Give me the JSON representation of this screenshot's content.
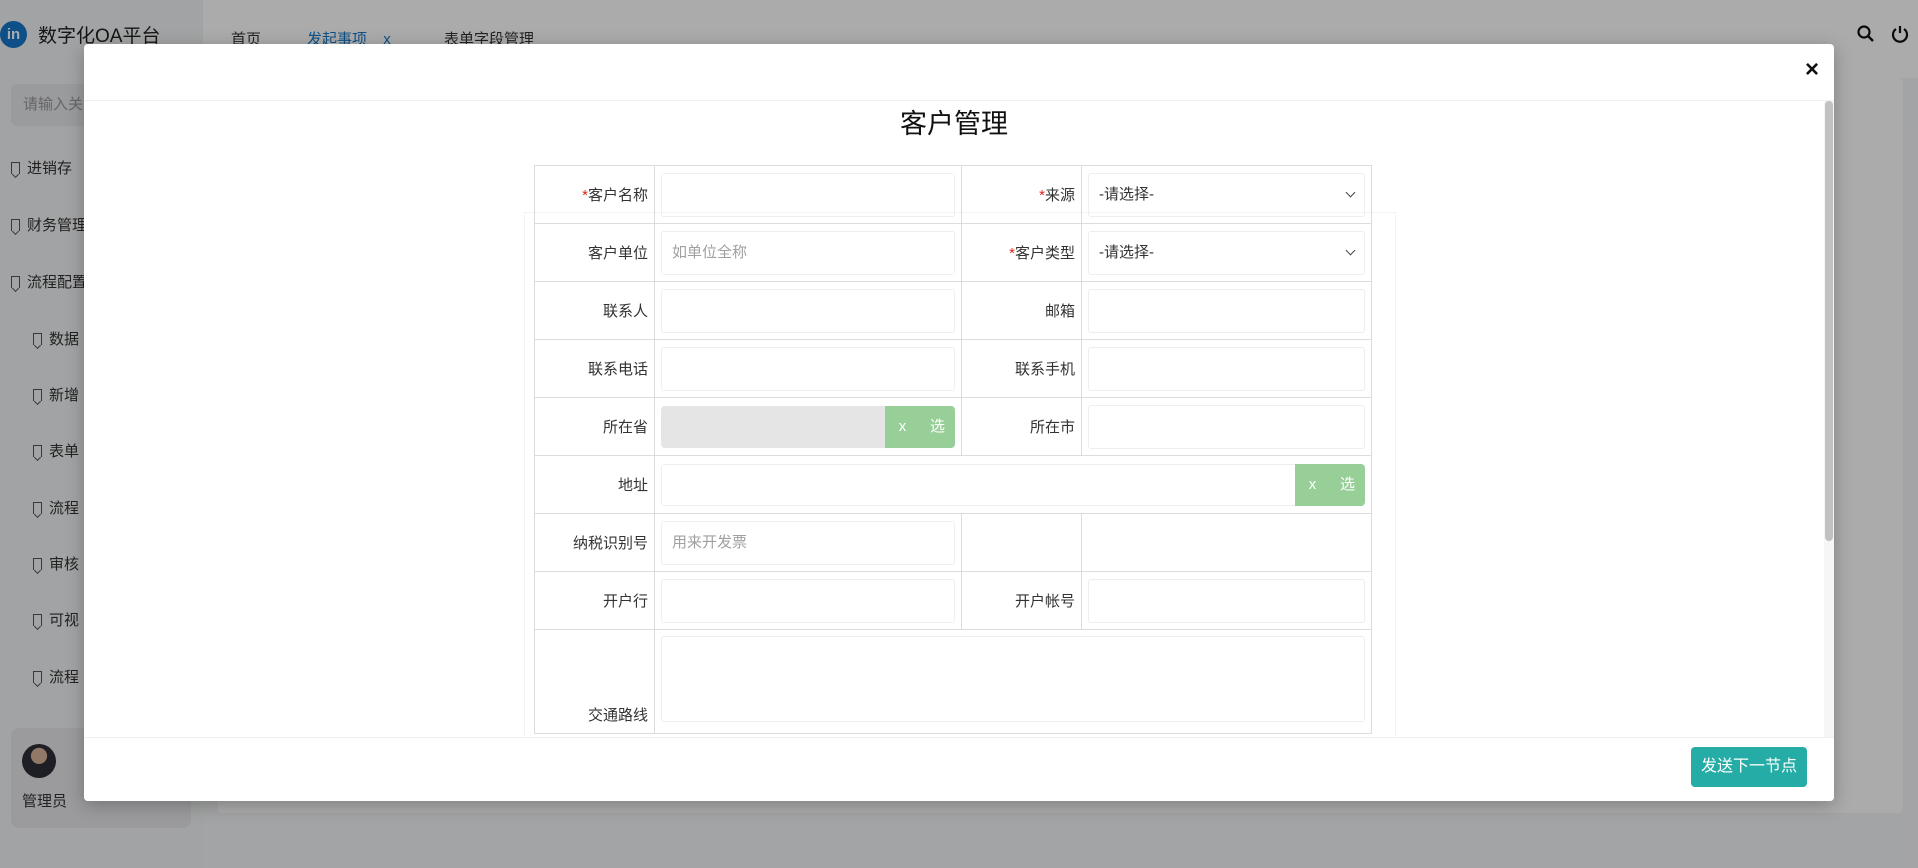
{
  "app": {
    "logo_badge": "in",
    "title": "数字化OA平台",
    "search_placeholder": "请输入关",
    "nav": [
      "进销存",
      "财务管理",
      "流程配置"
    ],
    "subnav": [
      "数据",
      "新增",
      "表单",
      "流程",
      "审核",
      "可视",
      "流程"
    ],
    "user": "管理员",
    "tabs": [
      "首页",
      "发起事项",
      "表单字段管理"
    ],
    "active_tab_close": "x"
  },
  "modal": {
    "title": "客户管理",
    "close": "×",
    "required_mark": "*",
    "fields": {
      "customer_name": "客户名称",
      "source": "来源",
      "source_value": "-请选择-",
      "customer_unit": "客户单位",
      "customer_unit_placeholder": "如单位全称",
      "customer_type": "客户类型",
      "customer_type_value": "-请选择-",
      "contact": "联系人",
      "email": "邮箱",
      "phone": "联系电话",
      "mobile": "联系手机",
      "province": "所在省",
      "city": "所在市",
      "address": "地址",
      "tax_id": "纳税识别号",
      "tax_id_placeholder": "用来开发票",
      "bank": "开户行",
      "bank_account": "开户帐号",
      "traffic_route": "交通路线"
    },
    "picker_clear": "x",
    "picker_select": "选",
    "submit": "发送下一节点"
  }
}
